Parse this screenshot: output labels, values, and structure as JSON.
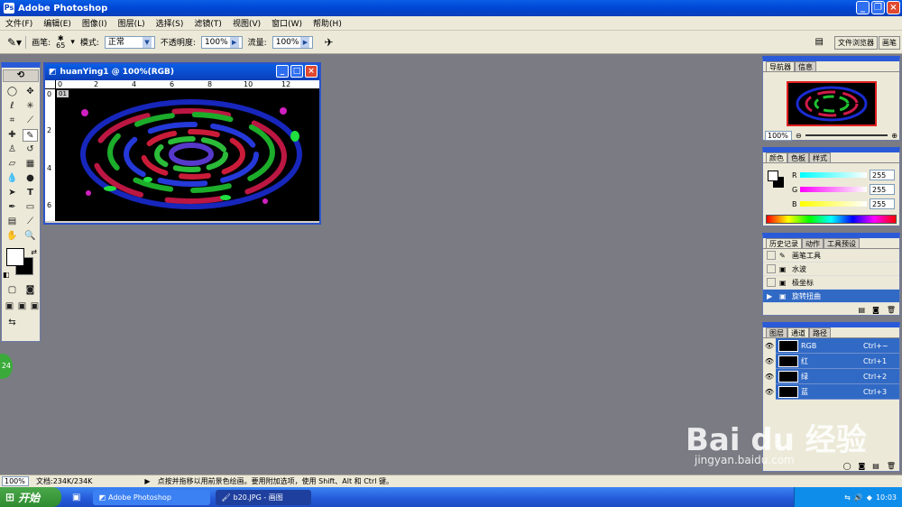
{
  "app": {
    "title": "Adobe Photoshop",
    "logo_text": "Ps"
  },
  "menu": [
    "文件(F)",
    "编辑(E)",
    "图像(I)",
    "图层(L)",
    "选择(S)",
    "滤镜(T)",
    "视图(V)",
    "窗口(W)",
    "帮助(H)"
  ],
  "options": {
    "brush_label": "画笔:",
    "brush_size": "65",
    "mode_label": "模式:",
    "mode_value": "正常",
    "opacity_label": "不透明度:",
    "opacity_value": "100%",
    "flow_label": "流量:",
    "flow_value": "100%"
  },
  "palette_well": [
    "文件浏览器",
    "画笔"
  ],
  "document": {
    "title": "huanYing1 @ 100%(RGB)",
    "ruler_h": [
      "0",
      "2",
      "4",
      "6",
      "8",
      "10",
      "12"
    ],
    "ruler_v": [
      "0",
      "2",
      "4",
      "6"
    ],
    "ruler_badge": "01"
  },
  "navigator": {
    "tabs": [
      "导航器",
      "信息"
    ],
    "zoom": "100%"
  },
  "color": {
    "tabs": [
      "颜色",
      "色板",
      "样式"
    ],
    "channels": [
      {
        "name": "R",
        "value": "255"
      },
      {
        "name": "G",
        "value": "255"
      },
      {
        "name": "B",
        "value": "255"
      }
    ]
  },
  "history": {
    "tabs": [
      "历史记录",
      "动作",
      "工具预设"
    ],
    "items": [
      {
        "label": "画笔工具",
        "selected": false
      },
      {
        "label": "水波",
        "selected": false
      },
      {
        "label": "极坐标",
        "selected": false
      },
      {
        "label": "旋转扭曲",
        "selected": true
      }
    ]
  },
  "channels": {
    "tabs": [
      "图层",
      "通道",
      "路径"
    ],
    "items": [
      {
        "name": "RGB",
        "shortcut": "Ctrl+~"
      },
      {
        "name": "红",
        "shortcut": "Ctrl+1"
      },
      {
        "name": "绿",
        "shortcut": "Ctrl+2"
      },
      {
        "name": "蓝",
        "shortcut": "Ctrl+3"
      }
    ]
  },
  "status": {
    "zoom": "100%",
    "doc": "文档:234K/234K",
    "hint": "点按并拖移以用前景色绘画。要用附加选项，使用 Shift、Alt 和 Ctrl 键。"
  },
  "taskbar": {
    "start": "开始",
    "tasks": [
      {
        "label": "Adobe Photoshop",
        "active": false
      },
      {
        "label": "b20.JPG - 画图",
        "active": true
      }
    ],
    "clock": "10:03"
  },
  "watermark": {
    "brand": "Bai du 经验",
    "url": "jingyan.baidu.com"
  },
  "side_badge": "24"
}
